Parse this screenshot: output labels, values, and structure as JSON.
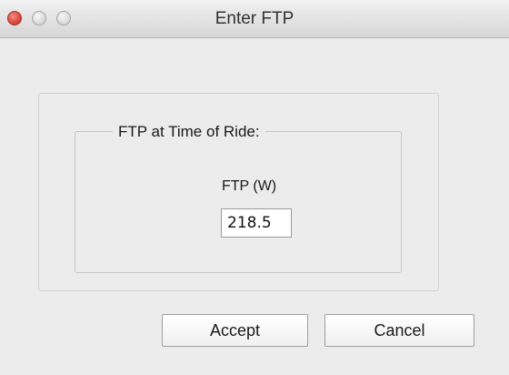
{
  "window": {
    "title": "Enter FTP"
  },
  "titlebar": {
    "buttons": [
      "close",
      "minimize",
      "zoom"
    ],
    "close_color": "#d8483e",
    "inactive_color": "#d6d6d6"
  },
  "form": {
    "group_label": "FTP at Time of Ride:",
    "field_label": "FTP (W)",
    "field_value": "218.5"
  },
  "actions": {
    "accept_label": "Accept",
    "cancel_label": "Cancel"
  }
}
